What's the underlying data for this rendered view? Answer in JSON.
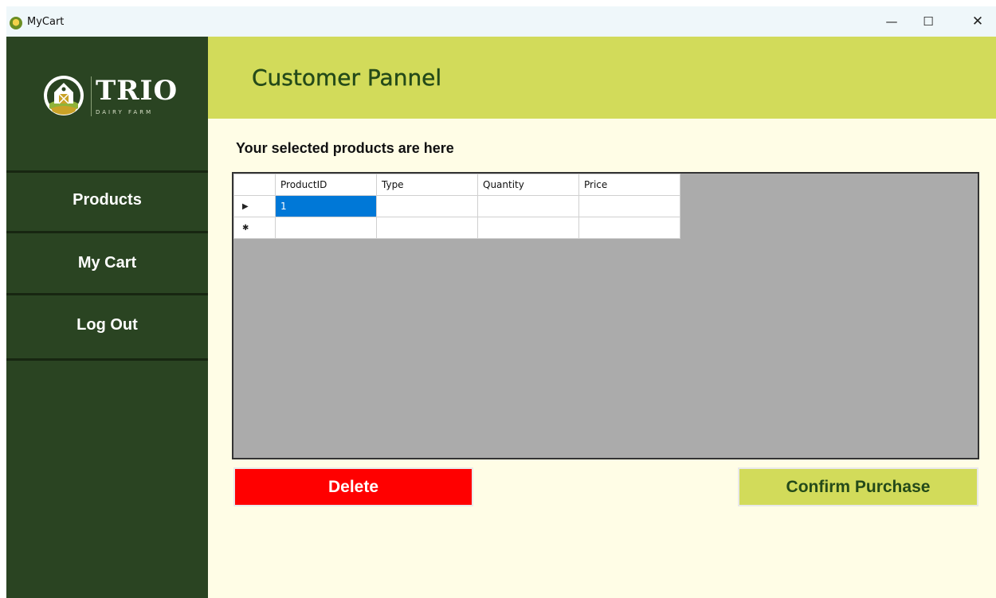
{
  "window": {
    "title": "MyCart",
    "controls": {
      "minimize": "—",
      "maximize": "☐",
      "close": "✕"
    }
  },
  "brand": {
    "name": "TRIO",
    "tagline": "DAIRY FARM",
    "icon": "barn-logo-icon"
  },
  "sidebar": {
    "items": [
      {
        "label": "Products"
      },
      {
        "label": "My Cart"
      },
      {
        "label": "Log Out"
      }
    ]
  },
  "header": {
    "title": "Customer Pannel"
  },
  "main": {
    "subtitle": "Your selected products are here",
    "grid": {
      "columns": [
        "ProductID",
        "Type",
        "Quantity",
        "Price"
      ],
      "rows": [
        {
          "marker": "▶",
          "cells": [
            "1",
            "",
            "",
            ""
          ]
        },
        {
          "marker": "✱",
          "cells": [
            "",
            "",
            "",
            ""
          ]
        }
      ]
    },
    "actions": {
      "delete_label": "Delete",
      "confirm_label": "Confirm Purchase"
    }
  },
  "colors": {
    "sidebar": "#2a4422",
    "header": "#d2db5a",
    "content": "#fffde6",
    "delete": "#ff0000",
    "grid_bg": "#ababab",
    "selection": "#0078d7"
  }
}
